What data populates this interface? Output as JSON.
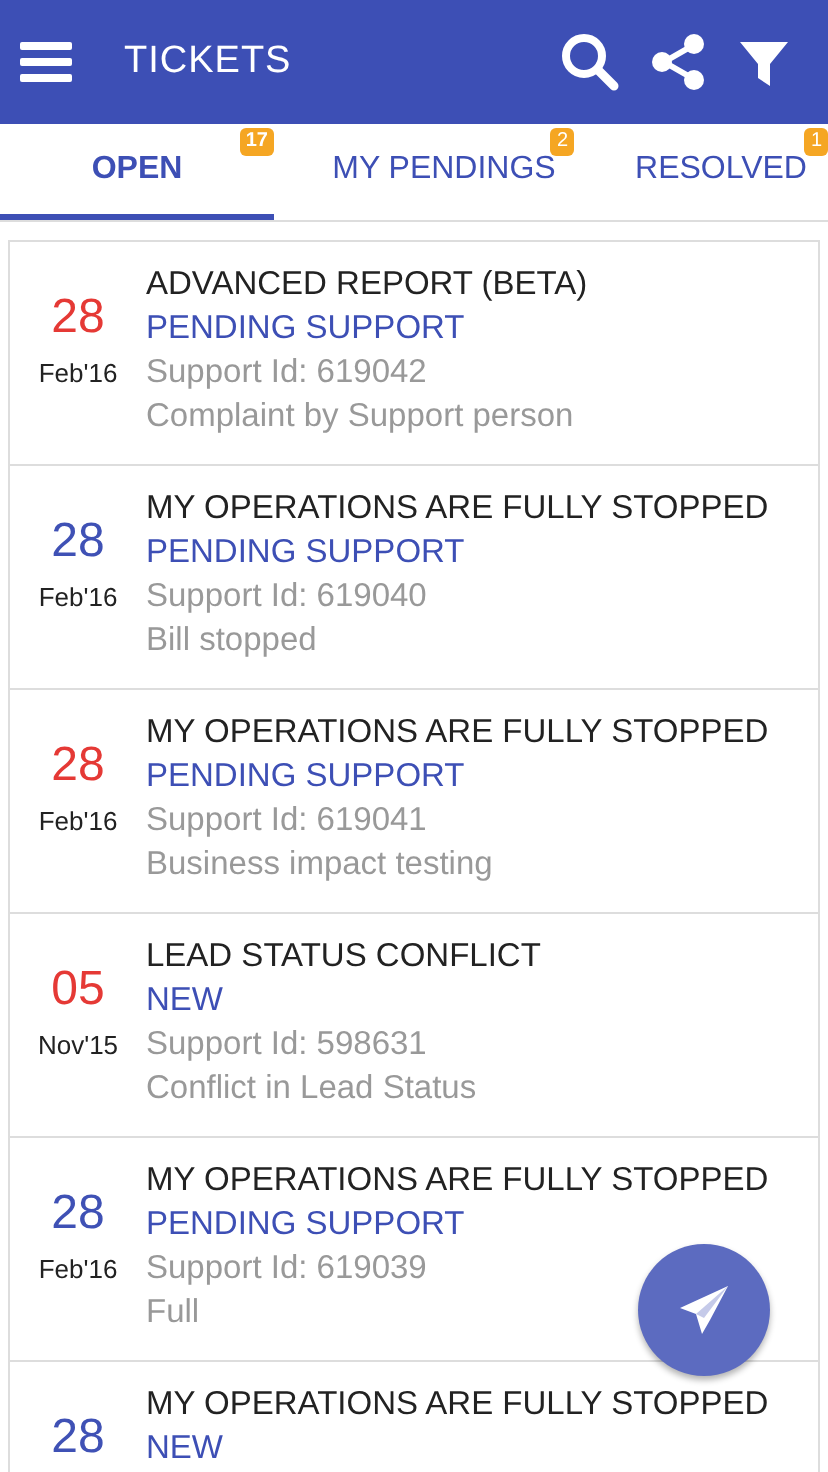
{
  "header": {
    "title": "TICKETS"
  },
  "tabs": [
    {
      "label": "OPEN",
      "count": "17",
      "selected": true
    },
    {
      "label": "MY PENDINGS",
      "count": "2",
      "selected": false
    },
    {
      "label": "RESOLVED",
      "count": "1",
      "selected": false
    }
  ],
  "tickets": [
    {
      "day": "28",
      "month": "Feb'16",
      "color": "#e53935",
      "title": "ADVANCED REPORT (BETA)",
      "status": "PENDING SUPPORT",
      "support_id": "Support Id: 619042",
      "description": "Complaint by Support person"
    },
    {
      "day": "28",
      "month": "Feb'16",
      "color": "#3f51b5",
      "title": "MY OPERATIONS ARE FULLY STOPPED",
      "status": "PENDING SUPPORT",
      "support_id": "Support Id: 619040",
      "description": "Bill stopped"
    },
    {
      "day": "28",
      "month": "Feb'16",
      "color": "#e53935",
      "title": "MY OPERATIONS ARE FULLY STOPPED",
      "status": "PENDING SUPPORT",
      "support_id": "Support Id: 619041",
      "description": "Business impact testing"
    },
    {
      "day": "05",
      "month": "Nov'15",
      "color": "#e53935",
      "title": "LEAD STATUS CONFLICT",
      "status": "NEW",
      "support_id": "Support Id: 598631",
      "description": "Conflict in Lead Status"
    },
    {
      "day": "28",
      "month": "Feb'16",
      "color": "#3f51b5",
      "title": "MY OPERATIONS ARE FULLY STOPPED",
      "status": "PENDING SUPPORT",
      "support_id": "Support Id: 619039",
      "description": "Full"
    },
    {
      "day": "28",
      "color": "#3f51b5",
      "title": "MY OPERATIONS ARE FULLY STOPPED",
      "status": "NEW"
    }
  ]
}
